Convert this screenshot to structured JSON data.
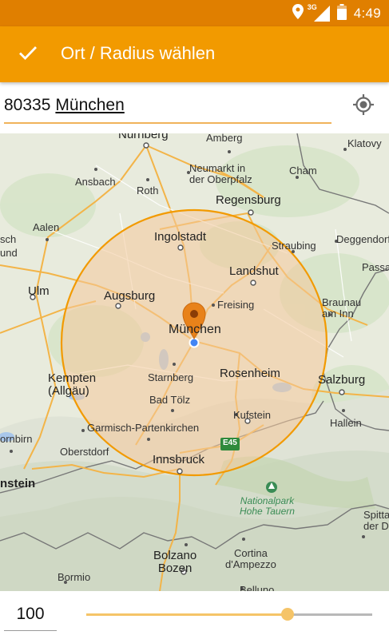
{
  "status_bar": {
    "time": "4:49",
    "network": "3G",
    "icons": [
      "location-icon",
      "signal-icon",
      "battery-icon"
    ]
  },
  "app_bar": {
    "title": "Ort / Radius wählen",
    "confirm_icon": "check-icon",
    "color": "#f29a00"
  },
  "location": {
    "zip": "80335",
    "city": "München",
    "locate_icon": "gps-target-icon"
  },
  "map": {
    "labels": {
      "nurnberg": "Nürnberg",
      "amberg": "Amberg",
      "klatovy": "Klatovy",
      "ansbach": "Ansbach",
      "neumarkt": "Neumarkt in\nder Oberpfalz",
      "cham": "Cham",
      "roth": "Roth",
      "regensburg": "Regensburg",
      "aalen": "Aalen",
      "sch": "sch",
      "und": "und",
      "ingolstadt": "Ingolstadt",
      "straubing": "Straubing",
      "deggendorf": "Deggendorf",
      "passau": "Passa",
      "landshut": "Landshut",
      "ulm": "Ulm",
      "augsburg": "Augsburg",
      "freising": "Freising",
      "braunau": "Braunau\nam Inn",
      "munchen": "München",
      "kempten": "Kempten\n(Allgäu)",
      "starnberg": "Starnberg",
      "rosenheim": "Rosenheim",
      "salzburg": "Salzburg",
      "badtolz": "Bad Tölz",
      "kufstein": "Kufstein",
      "hallein": "Hallein",
      "garmisch": "Garmisch-Partenkirchen",
      "dornbirn": "ornbirn",
      "oberstdorf": "Oberstdorf",
      "e45": "E45",
      "innsbruck": "Innsbruck",
      "nstein": "nstein",
      "nationalpark": "Nationalpark\nHohe Tauern",
      "spittal": "Spitta\nder Dr",
      "bolzano": "Bolzano\nBozen",
      "cortina": "Cortina\nd'Ampezzo",
      "bormio": "Bormio",
      "belluno": "Belluno"
    },
    "radius_circle_color": "#f29a00",
    "pin_color": "#e8821a"
  },
  "radius": {
    "value": "100",
    "slider_fraction": 0.705
  }
}
